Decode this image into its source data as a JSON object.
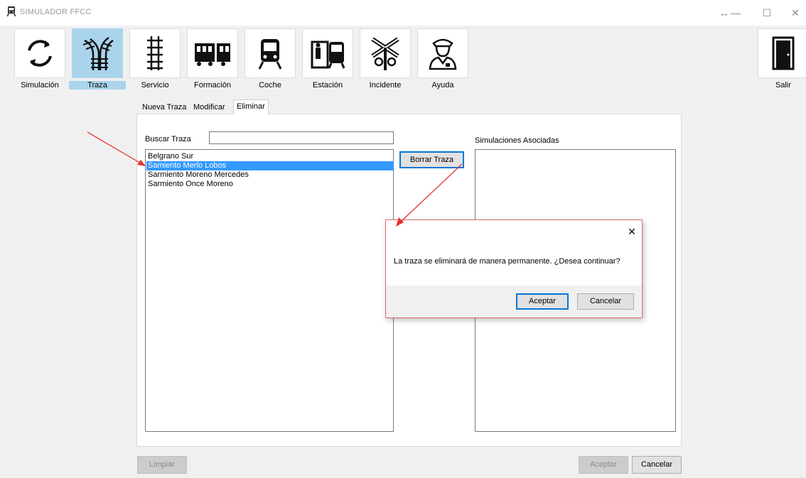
{
  "window": {
    "title": "SIMULADOR FFCC",
    "controls": [
      "↔",
      "—",
      "☐",
      "✕"
    ]
  },
  "toolbar": {
    "items": [
      {
        "label": "Simulación",
        "icon": "refresh-icon",
        "active": false
      },
      {
        "label": "Traza",
        "icon": "railroad-switch-icon",
        "active": true
      },
      {
        "label": "Servicio",
        "icon": "rail-track-icon",
        "active": false
      },
      {
        "label": "Formación",
        "icon": "train-cars-icon",
        "active": false
      },
      {
        "label": "Coche",
        "icon": "train-front-icon",
        "active": false
      },
      {
        "label": "Estación",
        "icon": "station-icon",
        "active": false
      },
      {
        "label": "Incidente",
        "icon": "railroad-crossing-icon",
        "active": false
      },
      {
        "label": "Ayuda",
        "icon": "conductor-icon",
        "active": false
      }
    ],
    "exit_label": "Salir"
  },
  "tabs": [
    {
      "label": "Nueva Traza",
      "selected": false
    },
    {
      "label": "Modificar",
      "selected": false
    },
    {
      "label": "Eliminar",
      "selected": true
    }
  ],
  "search": {
    "label": "Buscar Traza",
    "value": ""
  },
  "trace_list": {
    "items": [
      {
        "label": "Belgrano Sur",
        "selected": false
      },
      {
        "label": "Samiento Merlo Lobos",
        "selected": true
      },
      {
        "label": "Sarmiento Moreno Mercedes",
        "selected": false
      },
      {
        "label": "Sarmiento Once Moreno",
        "selected": false
      }
    ]
  },
  "delete_button": "Borrar Traza",
  "associated": {
    "label": "Simulaciones Asociadas"
  },
  "footer": {
    "clear": "Limpiar",
    "accept": "Aceptar",
    "cancel": "Cancelar"
  },
  "dialog": {
    "message": "La traza se eliminará de manera permanente. ¿Desea continuar?",
    "accept": "Aceptar",
    "cancel": "Cancelar",
    "close": "✕"
  },
  "colors": {
    "active_tool": "#a9d4ec",
    "selection": "#3399ff",
    "annotation_arrow": "#e83030"
  }
}
